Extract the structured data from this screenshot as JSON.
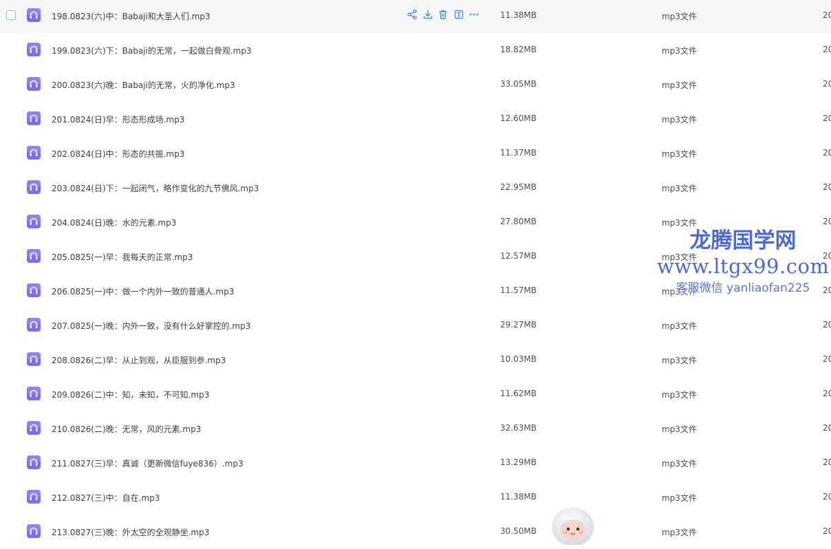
{
  "file_list": {
    "rows": [
      {
        "name": "198.0823(六)中：Babaji和大圣人们.mp3",
        "size": "11.38MB",
        "type": "mp3文件",
        "date": "20",
        "hover": true
      },
      {
        "name": "199.0823(六)下：Babaji的无常，一起做白骨观.mp3",
        "size": "18.82MB",
        "type": "mp3文件",
        "date": "20"
      },
      {
        "name": "200.0823(六)晚：Babaji的无常，火的净化.mp3",
        "size": "33.05MB",
        "type": "mp3文件",
        "date": "20"
      },
      {
        "name": "201.0824(日)早：形态形成场.mp3",
        "size": "12.60MB",
        "type": "mp3文件",
        "date": "20"
      },
      {
        "name": "202.0824(日)中：形态的共振.mp3",
        "size": "11.37MB",
        "type": "mp3文件",
        "date": "20"
      },
      {
        "name": "203.0824(日)下：一起闭气，略作变化的九节佛风.mp3",
        "size": "22.95MB",
        "type": "mp3文件",
        "date": "20"
      },
      {
        "name": "204.0824(日)晚：水的元素.mp3",
        "size": "27.80MB",
        "type": "mp3文件",
        "date": "20"
      },
      {
        "name": "205.0825(一)早：我每天的正常.mp3",
        "size": "12.57MB",
        "type": "mp3文件",
        "date": "20"
      },
      {
        "name": "206.0825(一)中：做一个内外一致的普通人.mp3",
        "size": "11.57MB",
        "type": "mp3文件",
        "date": "20"
      },
      {
        "name": "207.0825(一)晚：内外一致，没有什么好掌控的.mp3",
        "size": "29.27MB",
        "type": "mp3文件",
        "date": "20"
      },
      {
        "name": "208.0826(二)早：从止到观，从臣服到参.mp3",
        "size": "10.03MB",
        "type": "mp3文件",
        "date": "20"
      },
      {
        "name": "209.0826(二)中：知，未知，不可知.mp3",
        "size": "11.62MB",
        "type": "mp3文件",
        "date": "20"
      },
      {
        "name": "210.0826(二)晚：无常，风的元素.mp3",
        "size": "32.63MB",
        "type": "mp3文件",
        "date": "20"
      },
      {
        "name": "211.0827(三)早：真诚（更新微信fuye836）.mp3",
        "size": "13.29MB",
        "type": "mp3文件",
        "date": "20"
      },
      {
        "name": "212.0827(三)中：自在.mp3",
        "size": "11.38MB",
        "type": "mp3文件",
        "date": "20"
      },
      {
        "name": "213.0827(三)晚：外太空的全观静坐.mp3",
        "size": "30.50MB",
        "type": "mp3文件",
        "date": "20"
      }
    ],
    "actions": [
      {
        "icon": "share-icon"
      },
      {
        "icon": "download-icon"
      },
      {
        "icon": "delete-icon"
      },
      {
        "icon": "rename-icon"
      },
      {
        "icon": "more-icon"
      }
    ],
    "file_icon": "audio-file-icon"
  },
  "watermark": {
    "title": "龙腾国学网",
    "url": "www.ltgx99.com",
    "contact": "客服微信 yanliaofan225"
  },
  "mascot": {
    "icon": "assistant-mascot-icon"
  },
  "colors": {
    "file_icon_bg": "#7b6ef6",
    "action_icon": "#4a8fe8",
    "hover_row_bg": "#f5f6f8",
    "watermark": "#2f4fcf"
  }
}
